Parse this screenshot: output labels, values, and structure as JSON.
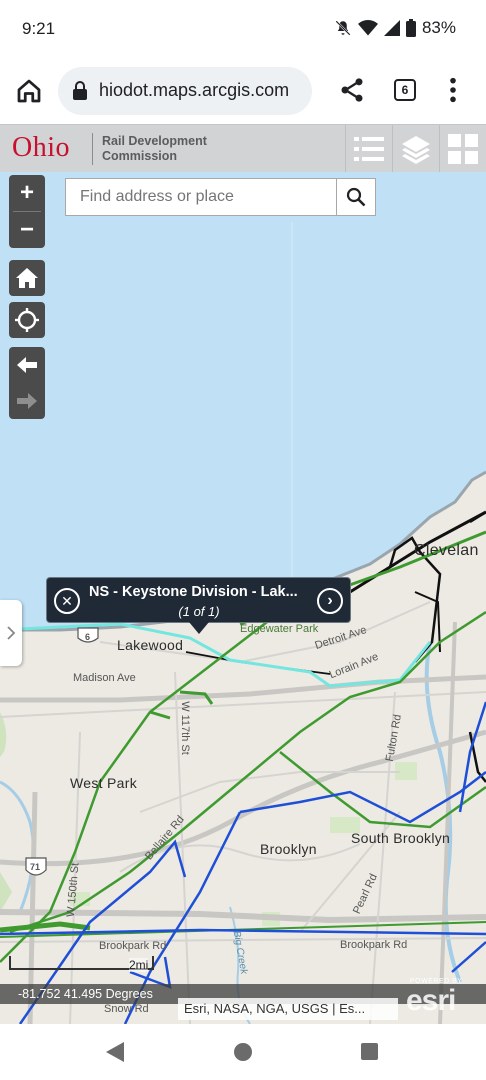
{
  "status": {
    "time": "9:21",
    "battery": "83%"
  },
  "browser": {
    "url": "hiodot.maps.arcgis.com",
    "tab_count": "6"
  },
  "app": {
    "logo": "Ohio",
    "org_line1": "Rail Development",
    "org_line2": "Commission"
  },
  "search": {
    "placeholder": "Find address or place"
  },
  "controls": {
    "zoom_in": "+",
    "zoom_out": "−"
  },
  "popup": {
    "title": "NS - Keystone Division - Lak...",
    "count": "(1 of 1)"
  },
  "map_labels": {
    "cleveland": "Clevelan",
    "lakewood": "Lakewood",
    "west_park": "West Park",
    "brooklyn": "Brooklyn",
    "south_brooklyn": "South Brooklyn",
    "madison_ave": "Madison Ave",
    "detroit_ave": "Detroit Ave",
    "lorain_ave": "Lorain Ave",
    "edgewater_park": "Edgewater Park",
    "w117th": "W 117th St",
    "w150th": "W 150th St",
    "bellaire_rd": "Bellaire Rd",
    "fulton_rd": "Fulton Rd",
    "pearl_rd": "Pearl Rd",
    "brookpark_rd_left": "Brookpark Rd",
    "brookpark_rd_right": "Brookpark Rd",
    "snow_rd": "Snow Rd",
    "big_creek": "Big Creek",
    "route_6": "6",
    "route_71": "71"
  },
  "scale": "2mi",
  "coordinates": "-81.752 41.495 Degrees",
  "attribution": "Esri, NASA, NGA, USGS | Es...",
  "esri": {
    "powered_by": "POWERED BY",
    "wordmark": "esri"
  },
  "colors": {
    "lake": "#bfe0f5",
    "land": "#eceae3",
    "rail_green": "#3f9a2f",
    "rail_blue": "#1f4fd6",
    "rail_black": "#111111",
    "rail_cyan": "#74e6e0",
    "header": "#d1d3d4",
    "logo_red": "#c8102e"
  },
  "icons": [
    "home-icon",
    "lock-icon",
    "share-icon",
    "tabs-icon",
    "more-vert-icon",
    "list-icon",
    "layers-icon",
    "grid-icon",
    "search-icon",
    "map-home-icon",
    "locate-icon",
    "arrow-left-icon",
    "arrow-right-icon",
    "close-circle-icon",
    "next-circle-icon",
    "chevron-right-icon"
  ]
}
